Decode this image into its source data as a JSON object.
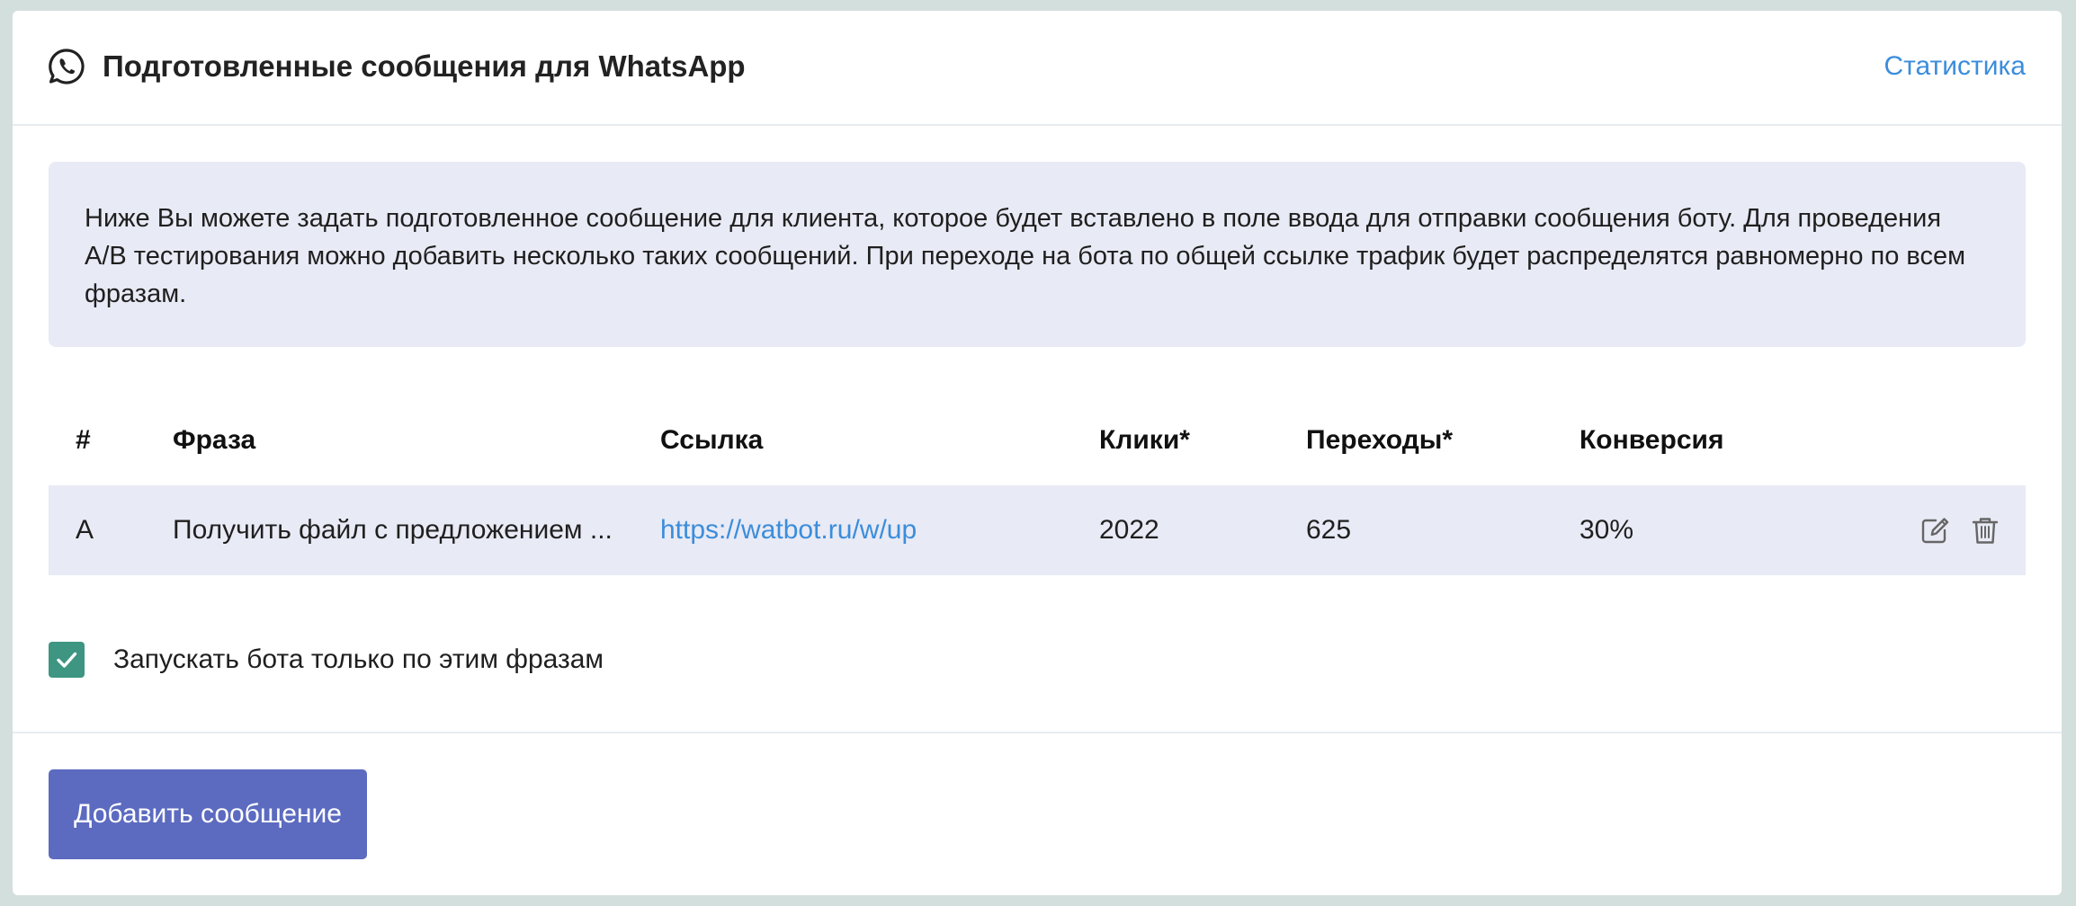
{
  "header": {
    "title": "Подготовленные сообщения для WhatsApp",
    "stats_link": "Статистика",
    "icon": "whatsapp-icon"
  },
  "info": {
    "text": "Ниже Вы можете задать подготовленное сообщение для клиента, которое будет вставлено в поле ввода для отправки сообщения боту. Для проведения A/B тестирования можно добавить несколько таких сообщений. При переходе на бота по общей ссылке трафик будет распределятся равномерно по всем фразам."
  },
  "table": {
    "columns": {
      "num": "#",
      "phrase": "Фраза",
      "link": "Ссылка",
      "clicks": "Клики*",
      "transitions": "Переходы*",
      "conversion": "Конверсия"
    },
    "rows": [
      {
        "num": "A",
        "phrase": "Получить файл с предложением ...",
        "link": "https://watbot.ru/w/up",
        "clicks": "2022",
        "transitions": "625",
        "conversion": "30%",
        "actions": [
          "edit-icon",
          "trash-icon"
        ]
      }
    ]
  },
  "option": {
    "label": "Запускать бота только по этим фразам",
    "checked": true
  },
  "footer": {
    "add_button": "Добавить сообщение"
  },
  "colors": {
    "accent": "#5c6bc0",
    "link": "#3b8ddb",
    "checkbox": "#3d9582",
    "panel_bg": "#e8eaf5",
    "page_bg": "#d3dfdc"
  }
}
